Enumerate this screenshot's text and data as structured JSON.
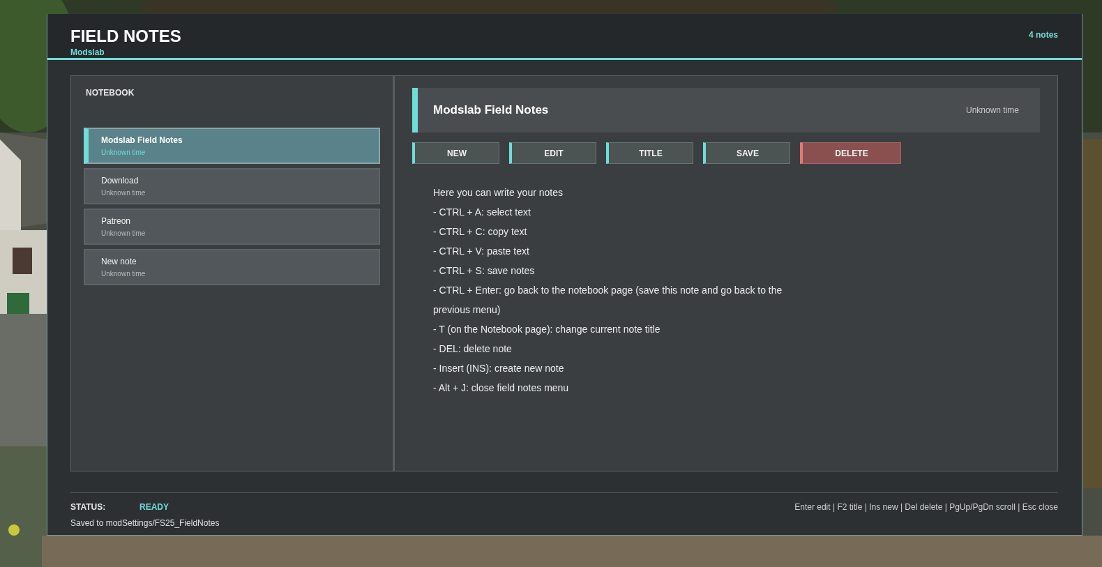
{
  "header": {
    "title": "FIELD NOTES",
    "subtitle": "Modslab",
    "count": "4 notes"
  },
  "sidebar": {
    "heading": "NOTEBOOK",
    "items": [
      {
        "title": "Modslab Field Notes",
        "time": "Unknown time",
        "selected": true
      },
      {
        "title": "Download",
        "time": "Unknown time",
        "selected": false
      },
      {
        "title": "Patreon",
        "time": "Unknown time",
        "selected": false
      },
      {
        "title": "New note",
        "time": "Unknown time",
        "selected": false
      }
    ]
  },
  "note": {
    "title": "Modslab Field Notes",
    "time": "Unknown time",
    "buttons": [
      {
        "label": "NEW",
        "kind": "normal"
      },
      {
        "label": "EDIT",
        "kind": "normal"
      },
      {
        "label": "TITLE",
        "kind": "normal"
      },
      {
        "label": "SAVE",
        "kind": "normal"
      },
      {
        "label": "DELETE",
        "kind": "danger"
      }
    ],
    "lines": [
      "Here you can write your notes",
      "- CTRL + A: select text",
      "- CTRL + C: copy text",
      "- CTRL + V: paste text",
      "- CTRL + S: save notes",
      "- CTRL + Enter: go back to the notebook page (save this note and go back to the previous menu)",
      "- T (on the Notebook page): change current note title",
      "- DEL: delete note",
      "- Insert (INS): create new note",
      "- Alt + J: close field notes menu"
    ]
  },
  "status_bar": {
    "label": "STATUS:",
    "state": "READY",
    "saved": "Saved to modSettings/FS25_FieldNotes",
    "hints": "Enter edit | F2 title | Ins new | Del delete | PgUp/PgDn scroll | Esc close"
  }
}
